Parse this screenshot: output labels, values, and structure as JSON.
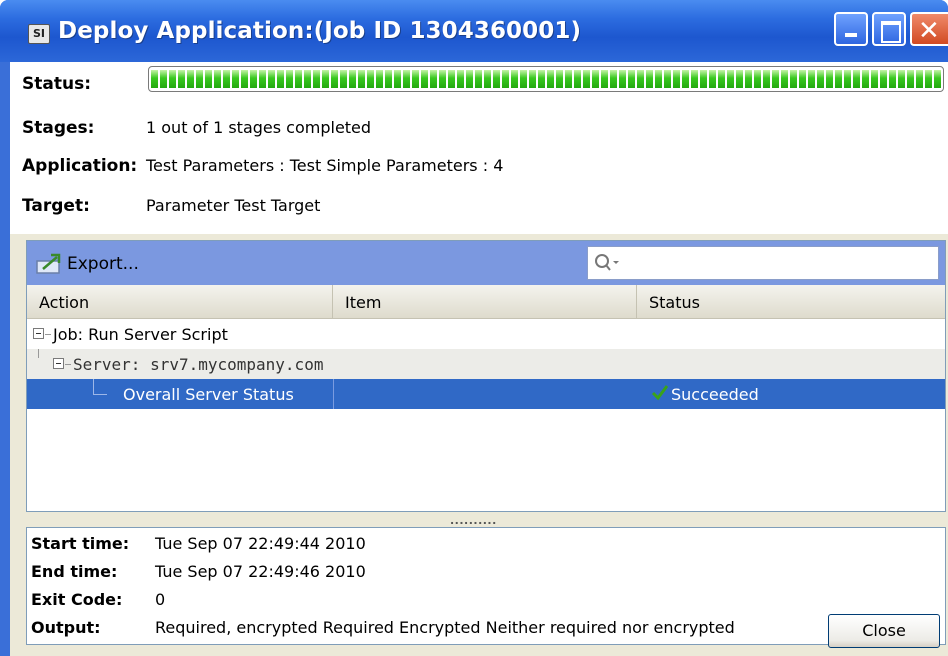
{
  "window": {
    "title": "Deploy Application:(Job ID 1304360001)",
    "icon_text": "SI"
  },
  "info": {
    "status_label": "Status:",
    "progress_percent": 100,
    "stages_label": "Stages:",
    "stages_value": "1 out of 1 stages completed",
    "application_label": "Application:",
    "application_value": "Test Parameters : Test Simple Parameters : 4",
    "target_label": "Target:",
    "target_value": "Parameter Test Target"
  },
  "toolbar": {
    "export_label": "Export...",
    "search_placeholder": ""
  },
  "grid": {
    "columns": [
      "Action",
      "Item",
      "Status"
    ],
    "rows": [
      {
        "action": "Job: Run Server Script",
        "item": "",
        "status": ""
      },
      {
        "action": "Server: srv7.mycompany.com",
        "item": "",
        "status": ""
      },
      {
        "action": "Overall Server Status",
        "item": "",
        "status": "Succeeded"
      }
    ]
  },
  "details": {
    "start_label": "Start time:",
    "start_value": "Tue Sep 07 22:49:44 2010",
    "end_label": "End time:",
    "end_value": "Tue Sep 07 22:49:46 2010",
    "exit_label": "Exit Code:",
    "exit_value": "0",
    "output_label": "Output:",
    "output_value": "Required, encrypted Required Encrypted Neither required nor encrypted"
  },
  "buttons": {
    "close_label": "Close"
  },
  "splitter_text": "..........",
  "colors": {
    "title_bar": "#2c67d8",
    "selection": "#3069c6",
    "toolbar": "#7b98e0",
    "progress_green": "#39c81e",
    "success_check": "#3aa21a"
  },
  "icons": [
    "app-icon",
    "minimize-icon",
    "maximize-icon",
    "close-icon",
    "export-icon",
    "search-icon",
    "tree-collapse-icon",
    "check-icon"
  ]
}
